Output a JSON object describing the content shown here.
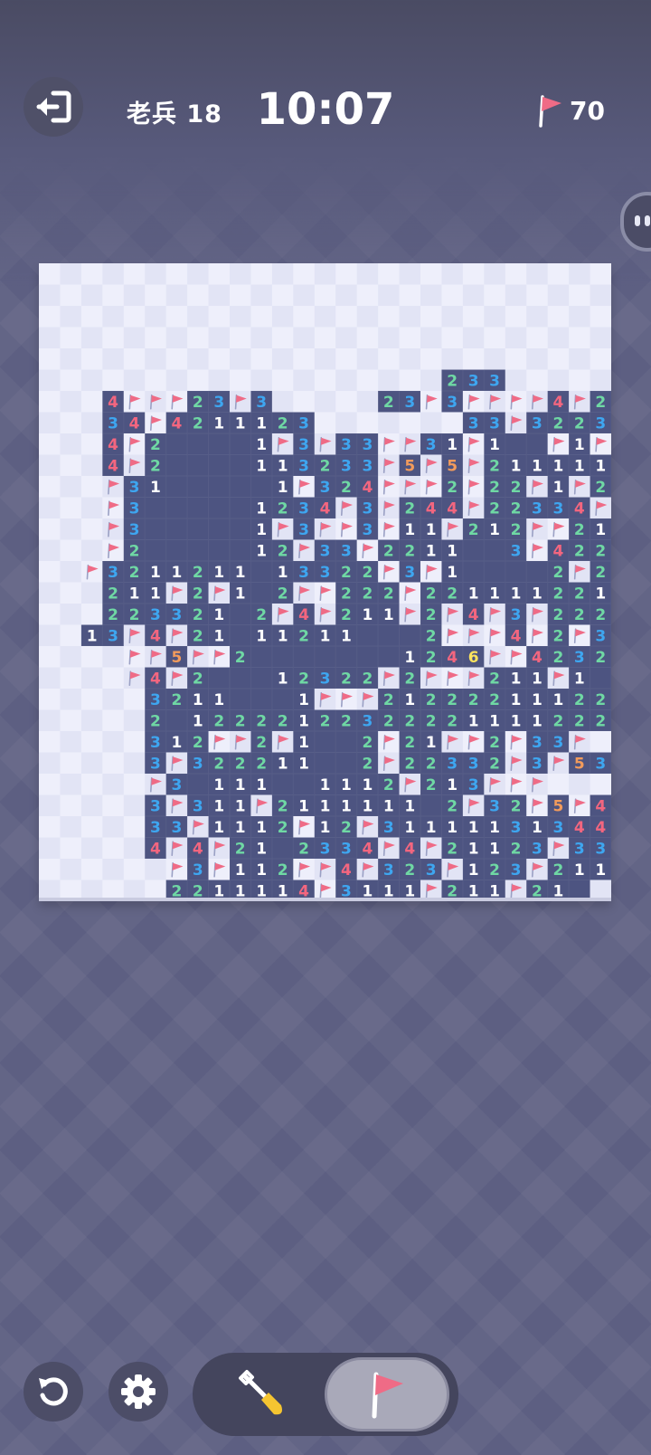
{
  "header": {
    "level_label": "老兵 18",
    "timer": "10:07",
    "flags_remaining": "70"
  },
  "icons": {
    "exit": "exit-icon",
    "restart": "restart-icon",
    "settings": "gear-icon",
    "dig_mode": "shovel-icon",
    "flag_mode": "flag-icon"
  },
  "controls": {
    "active_mode": "flag"
  },
  "colors": {
    "background": "#5d5f82",
    "revealed_cell": "#4d5481",
    "hidden_light": "#eeeffb",
    "hidden_dark": "#e2e4f5",
    "flag": "#ef6b86",
    "n1": "#ffffff",
    "n2": "#6fd8a4",
    "n3": "#3ea6f0",
    "n4": "#f3667f",
    "n5": "#f29b5c",
    "n6": "#fde45d"
  },
  "board": {
    "cols": 27,
    "rows": 30,
    "legend": {
      "?": "unrevealed",
      "F": "flagged",
      ".": "revealed empty",
      "1-8": "revealed number"
    },
    "grid": [
      "???????????????????????????",
      "???????????????????????????",
      "???????????????????????????",
      "???????????????????????????",
      "???????????????????????????",
      "???????????????????233??????",
      "???4FFF23F3?????23F3FFFF4F2",
      "???34F4211123???????33F32234F532",
      "???4F2....1F3F33FF31F1..F1F2FF2",
      "???4F2....113233F5F5F21111112F4F2",
      "???F31.....1F324FFF2F22F1F2F31",
      "???F3.....1234F3F244F22334F2.",
      "???F3.....1F3FF3F11F212FF21.",
      "???F2.....12F33F2211..3F4222",
      "??F3211211.13322F3F1....2F21FF",
      "???211F2F1.2FF222F2211112212F4F",
      "???223321.2F4F211F2F4F3F222F3",
      "??13F4F21.11211...2FFF4F2F3F",
      "????FF5FF2.......1246FF42322 1",
      "????F4F2...12322F2FFF211F1.",
      "?????3211...1FFF212222111221.",
      "?????2.1222212232222111122222F21",
      "?????312FF2F1..2F21FF2F33F",
      "?????3F322211..2F22332F3F53",
      "?????F3.111..1112F213FFF",
      "?????3F311F2111111.2F32F5F4",
      "?????33F1112F12F31111131344F3",
      "?????4F4F21.2334F4F21123F33F2",
      "??????F3F112FF4F323F123F211",
      "??????2211114F3111F211F21."
    ]
  }
}
